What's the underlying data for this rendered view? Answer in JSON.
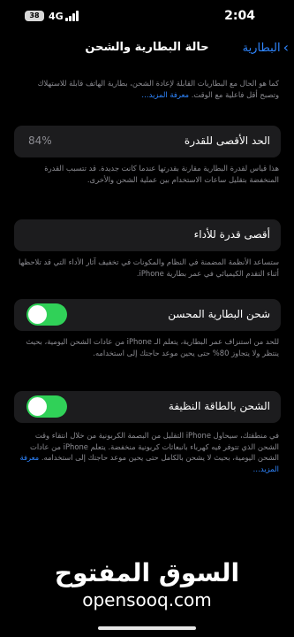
{
  "status_bar": {
    "battery": "38",
    "network": "4G",
    "time": "2:04"
  },
  "nav": {
    "title": "حالة البطارية والشحن",
    "back_label": "البطارية"
  },
  "intro": {
    "text": "كما هو الحال مع البطاريات القابلة لإعادة الشحن، بطارية الهاتف قابلة للاستهلاك وتصبح أقل فاعلية مع الوقت.",
    "link": "معرفة المزيد…"
  },
  "max_capacity": {
    "label": "الحد الأقصى للقدرة",
    "value": "84%",
    "description": "هذا قياس لقدرة البطارية مقارنة بقدرتها عندما كانت جديدة. قد تتسبب القدرة المنخفضة بتقليل ساعات الاستخدام بين عملية الشحن والأخرى."
  },
  "peak_performance": {
    "label": "أقصى قدرة للأداء",
    "description": "ستساعد الأنظمة المضمنة في النظام والمكونات في تخفيف آثار الأداء التي قد تلاحظها أثناء التقدم الكيميائي في عمر بطارية iPhone."
  },
  "optimized_charging": {
    "label": "شحن البطارية المحسن",
    "enabled": true,
    "description": "للحد من استنزاف عمر البطارية، يتعلم الـ iPhone من عادات الشحن اليومية، بحيث ينتظر ولا يتجاوز 80% حتى يحين موعد حاجتك إلى استخدامه."
  },
  "clean_energy": {
    "label": "الشحن بالطاقة النظيفة",
    "enabled": true,
    "description": "في منطقتك، سيحاول iPhone التقليل من البصمة الكربونية من خلال انتقاء وقت الشحن الذي تتوفر فيه كهرباء بانبعاثات كربونية منخفضة. يتعلم iPhone من عادات الشحن اليومية، بحيث لا يشحن بالكامل حتى يحين موعد حاجتك إلى استخدامه.",
    "link": "معرفة المزيد…"
  },
  "watermark": {
    "arabic": "السوق المفتوح",
    "english": "opensooq.com"
  },
  "colors": {
    "accent": "#2f86ff",
    "toggle_on": "#30d158",
    "card": "#1c1c1e",
    "secondary_text": "#8d8d93"
  }
}
